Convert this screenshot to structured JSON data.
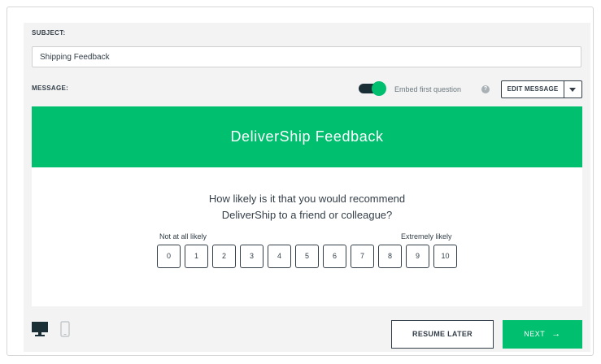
{
  "colors": {
    "accent": "#00bf6f",
    "dark": "#333e48",
    "panel_background": "#f3f3f3"
  },
  "form": {
    "subject_label": "SUBJECT:",
    "subject_value": "Shipping Feedback",
    "message_label": "MESSAGE:",
    "embed_toggle_on": true,
    "embed_label": "Embed first question",
    "help_icon": "question-circle-icon",
    "edit_message_label": "EDIT MESSAGE"
  },
  "preview": {
    "banner_title": "DeliverShip Feedback",
    "question_line1": "How likely is it that you would recommend",
    "question_line2": "DeliverShip to a friend or colleague?",
    "low_label": "Not at all likely",
    "high_label": "Extremely likely",
    "scale": [
      "0",
      "1",
      "2",
      "3",
      "4",
      "5",
      "6",
      "7",
      "8",
      "9",
      "10"
    ]
  },
  "footer": {
    "desktop_icon": "desktop-icon",
    "mobile_icon": "mobile-icon",
    "resume_label": "RESUME LATER",
    "next_label": "NEXT",
    "next_arrow": "→"
  }
}
